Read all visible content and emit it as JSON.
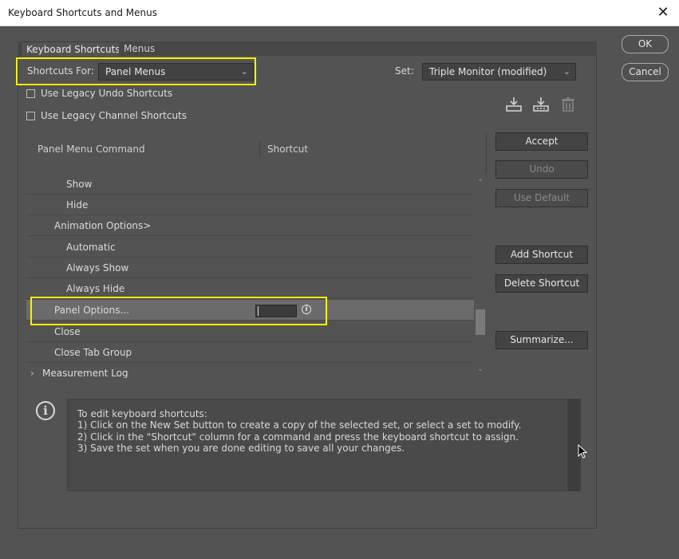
{
  "window": {
    "title": "Keyboard Shortcuts and Menus",
    "close_glyph": "✕"
  },
  "tabs": [
    {
      "label": "Keyboard Shortcuts"
    },
    {
      "label": "Menus"
    }
  ],
  "shortcuts_for": {
    "label": "Shortcuts For:",
    "value": "Panel Menus"
  },
  "set": {
    "label": "Set:",
    "value": "Triple Monitor (modified)"
  },
  "options": {
    "legacy_undo": "Use Legacy Undo Shortcuts",
    "legacy_channel": "Use Legacy Channel Shortcuts"
  },
  "columns": {
    "command": "Panel Menu Command",
    "shortcut": "Shortcut"
  },
  "rows": [
    {
      "label": "Show"
    },
    {
      "label": "Hide"
    },
    {
      "label": "Animation Options>"
    },
    {
      "label": "Automatic"
    },
    {
      "label": "Always Show"
    },
    {
      "label": "Always Hide"
    },
    {
      "label": "Panel Options..."
    },
    {
      "label": "Close"
    },
    {
      "label": "Close Tab Group"
    },
    {
      "label": "Measurement Log",
      "expander": "›"
    }
  ],
  "buttons": {
    "ok": "OK",
    "cancel": "Cancel",
    "accept": "Accept",
    "undo": "Undo",
    "use_default": "Use Default",
    "add_shortcut": "Add Shortcut",
    "delete_shortcut": "Delete Shortcut",
    "summarize": "Summarize..."
  },
  "info": {
    "lines": [
      "To edit keyboard shortcuts:",
      "1) Click on the New Set button to create a copy of the selected set, or select a set to modify.",
      "2) Click in the \"Shortcut\" column for a command and press the keyboard shortcut to assign.",
      "3) Save the set when you are done editing to save all your changes."
    ]
  },
  "icons": {
    "save_set": "save-set-icon",
    "new_set": "new-set-icon",
    "delete_set": "trash-icon",
    "info": "info-icon",
    "chevron": "⌄"
  },
  "colors": {
    "highlight": "#f7f300",
    "selected_row": "#6b6b6b",
    "dialog_bg": "#535353"
  }
}
